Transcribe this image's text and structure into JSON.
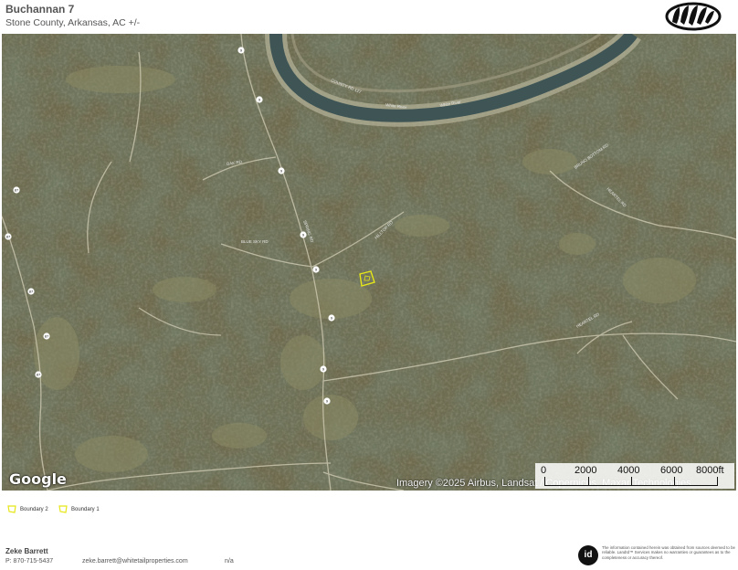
{
  "header": {
    "title": "Buchannan 7",
    "subtitle": "Stone County, Arkansas,  AC +/-"
  },
  "map": {
    "provider_logo": "Google",
    "attribution": "Imagery ©2025 Airbus, Landsat / Copernicus, Maxar Technologies",
    "road_labels": [
      "COUNTY RD 127",
      "White River",
      "White River",
      "HILLTOP RD",
      "BLUE SKY RD",
      "OAK RD",
      "BRUNO BOTTOM RD",
      "HEARTEL RD",
      "HEARTEL RD",
      "SPRING RD"
    ],
    "route_shields": [
      "9",
      "9",
      "9",
      "9",
      "9",
      "9",
      "9",
      "9",
      "87",
      "87",
      "87",
      "87",
      "87"
    ],
    "boundary_color": "#e6e619",
    "scale_bar": {
      "labels": [
        "0",
        "2000",
        "4000",
        "6000",
        "8000ft"
      ]
    }
  },
  "legend": [
    {
      "label": "Boundary 2",
      "color": "#e6e619"
    },
    {
      "label": "Boundary 1",
      "color": "#e6e619"
    }
  ],
  "footer": {
    "agent_name": "Zeke Barrett",
    "agent_phone": "P: 870-715-5437",
    "agent_email": "zeke.barrett@whitetailproperties.com",
    "agent_extra": "n/a",
    "id_logo": "id",
    "disclaimer": "The information contained herein was obtained from sources deemed to be reliable. LandId™ Services makes no warranties or guarantees as to the completeness or accuracy thereof."
  }
}
